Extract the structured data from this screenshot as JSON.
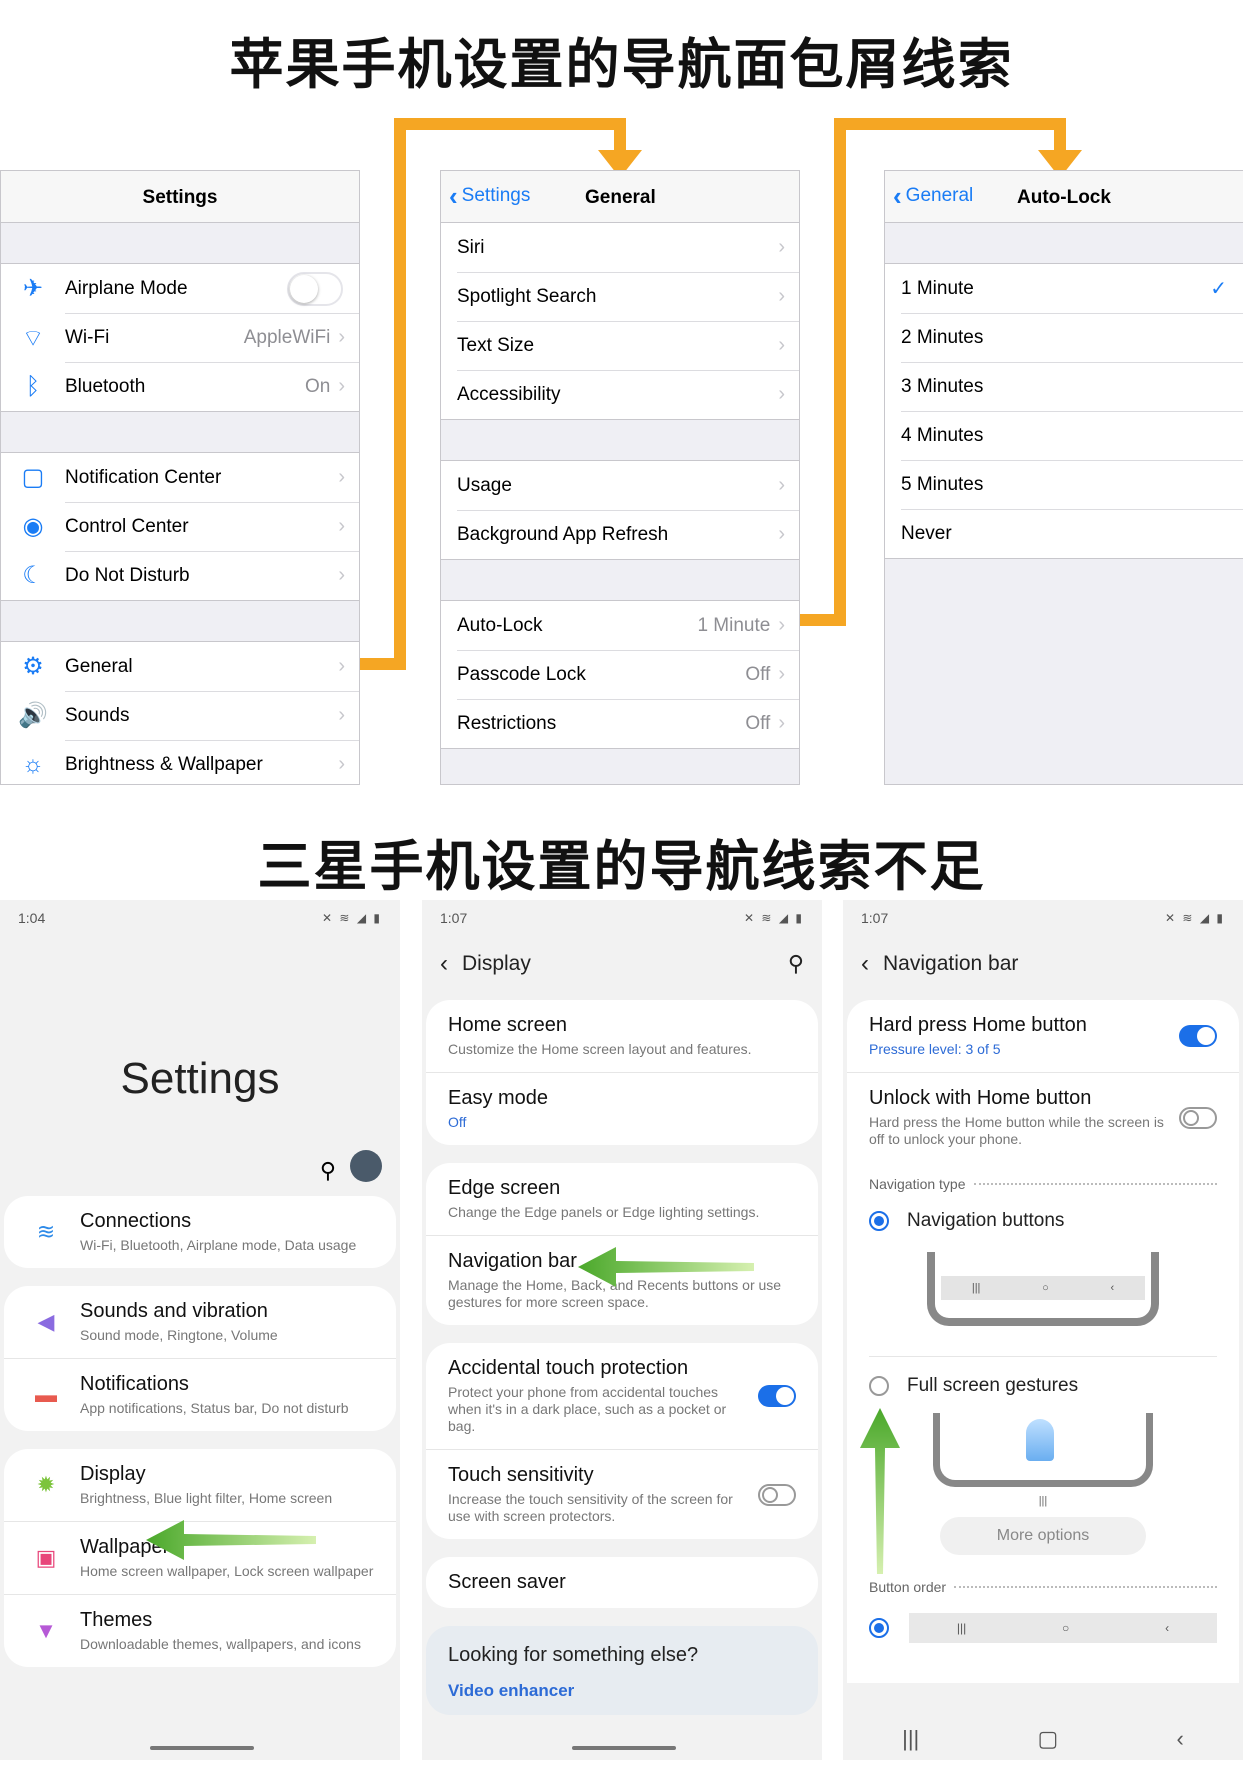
{
  "headings": {
    "top": "苹果手机设置的导航面包屑线索",
    "bottom": "三星手机设置的导航线索不足"
  },
  "ios": {
    "settings": {
      "title": "Settings",
      "group1": [
        {
          "icon": "airplane-icon",
          "glyph": "✈",
          "label": "Airplane Mode",
          "value": "",
          "toggle": true
        },
        {
          "icon": "wifi-icon",
          "glyph": "⌔",
          "label": "Wi-Fi",
          "value": "AppleWiFi"
        },
        {
          "icon": "bluetooth-icon",
          "glyph": "ᛒ",
          "label": "Bluetooth",
          "value": "On"
        }
      ],
      "group2": [
        {
          "icon": "notification-center-icon",
          "glyph": "▢",
          "label": "Notification Center"
        },
        {
          "icon": "control-center-icon",
          "glyph": "◉",
          "label": "Control Center"
        },
        {
          "icon": "moon-icon",
          "glyph": "☾",
          "label": "Do Not Disturb"
        }
      ],
      "group3": [
        {
          "icon": "gear-icon",
          "glyph": "⚙",
          "label": "General"
        },
        {
          "icon": "speaker-icon",
          "glyph": "🔊",
          "label": "Sounds"
        },
        {
          "icon": "sun-icon",
          "glyph": "☼",
          "label": "Brightness & Wallpaper"
        }
      ]
    },
    "general": {
      "back": "Settings",
      "title": "General",
      "group1": [
        "Siri",
        "Spotlight Search",
        "Text Size",
        "Accessibility"
      ],
      "group2": [
        "Usage",
        "Background App Refresh"
      ],
      "group3": [
        {
          "label": "Auto-Lock",
          "value": "1 Minute"
        },
        {
          "label": "Passcode Lock",
          "value": "Off"
        },
        {
          "label": "Restrictions",
          "value": "Off"
        }
      ]
    },
    "autolock": {
      "back": "General",
      "title": "Auto-Lock",
      "options": [
        "1 Minute",
        "2 Minutes",
        "3 Minutes",
        "4 Minutes",
        "5 Minutes",
        "Never"
      ],
      "selected_index": 0
    }
  },
  "samsung": {
    "settings": {
      "time": "1:04",
      "title": "Settings",
      "cards": [
        [
          {
            "icon": "wifi-icon",
            "glyph": "≋",
            "color": "#2d8ae8",
            "title": "Connections",
            "sub": "Wi-Fi, Bluetooth, Airplane mode, Data usage"
          }
        ],
        [
          {
            "icon": "speaker-icon",
            "glyph": "◀",
            "color": "#8a6be0",
            "title": "Sounds and vibration",
            "sub": "Sound mode, Ringtone, Volume"
          },
          {
            "icon": "bell-icon",
            "glyph": "▬",
            "color": "#e85a4f",
            "title": "Notifications",
            "sub": "App notifications, Status bar, Do not disturb"
          }
        ],
        [
          {
            "icon": "sun-icon",
            "glyph": "✹",
            "color": "#7cc43c",
            "title": "Display",
            "sub": "Brightness, Blue light filter, Home screen"
          },
          {
            "icon": "wallpaper-icon",
            "glyph": "▣",
            "color": "#e8457a",
            "title": "Wallpaper",
            "sub": "Home screen wallpaper, Lock screen wallpaper"
          },
          {
            "icon": "brush-icon",
            "glyph": "▼",
            "color": "#b659d6",
            "title": "Themes",
            "sub": "Downloadable themes, wallpapers, and icons"
          }
        ]
      ]
    },
    "display": {
      "time": "1:07",
      "title": "Display",
      "cards": [
        [
          {
            "title": "Home screen",
            "sub": "Customize the Home screen layout and features."
          },
          {
            "title": "Easy mode",
            "sub": "Off",
            "blue": true
          }
        ],
        [
          {
            "title": "Edge screen",
            "sub": "Change the Edge panels or Edge lighting settings."
          },
          {
            "title": "Navigation bar",
            "sub": "Manage the Home, Back, and Recents buttons or use gestures for more screen space."
          }
        ],
        [
          {
            "title": "Accidental touch protection",
            "sub": "Protect your phone from accidental touches when it's in a dark place, such as a pocket or bag.",
            "switch": "on"
          },
          {
            "title": "Touch sensitivity",
            "sub": "Increase the touch sensitivity of the screen for use with screen protectors.",
            "switch": "off"
          }
        ],
        [
          {
            "title": "Screen saver",
            "sub": ""
          }
        ]
      ],
      "footer_title": "Looking for something else?",
      "footer_link": "Video enhancer"
    },
    "navbar": {
      "time": "1:07",
      "title": "Navigation bar",
      "hard_press": {
        "title": "Hard press Home button",
        "sub": "Pressure level: 3 of 5"
      },
      "unlock": {
        "title": "Unlock with Home button",
        "sub": "Hard press the Home button while the screen is off to unlock your phone."
      },
      "nav_type_label": "Navigation type",
      "option_buttons": "Navigation buttons",
      "option_gestures": "Full screen gestures",
      "more_options": "More options",
      "button_order_label": "Button order"
    }
  },
  "colors": {
    "ios_blue": "#1a7cf5",
    "orange_connector": "#f5a623",
    "green_arrow": "#6cbf3a",
    "samsung_blue": "#1b6fe8"
  }
}
